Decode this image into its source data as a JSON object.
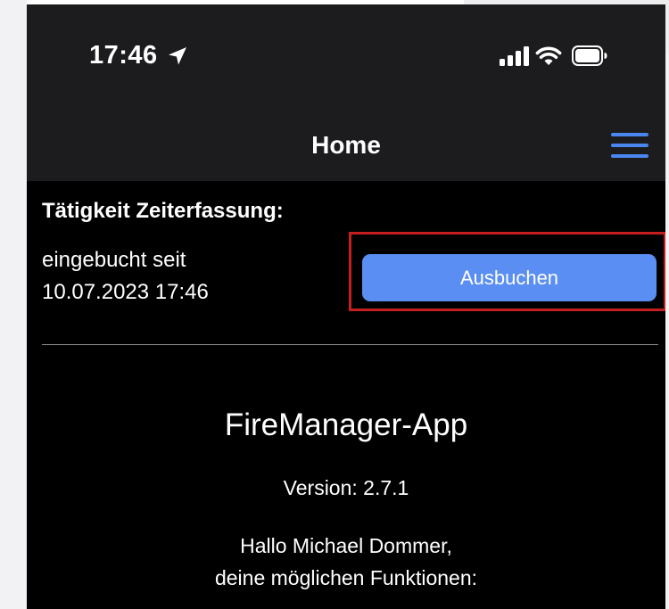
{
  "status_bar": {
    "time": "17:46",
    "icons": [
      "location-arrow-icon",
      "signal-bars-icon",
      "wifi-icon",
      "battery-icon"
    ]
  },
  "nav": {
    "title": "Home",
    "menu_icon": "hamburger-menu-icon"
  },
  "time_tracking": {
    "section_title": "Tätigkeit Zeiterfassung:",
    "status_line1": "eingebucht seit",
    "status_line2": "10.07.2023 17:46",
    "button_label": "Ausbuchen"
  },
  "app_info": {
    "name": "FireManager-App",
    "version": "Version: 2.7.1",
    "greeting": "Hallo Michael Dommer,",
    "functions_text": "deine möglichen Funktionen:"
  },
  "colors": {
    "accent": "#5a8ef2",
    "menu_icon": "#4a86f0",
    "highlight_border": "#c41e1e",
    "bar_background": "#1c1c1e",
    "page_background": "#000000"
  }
}
